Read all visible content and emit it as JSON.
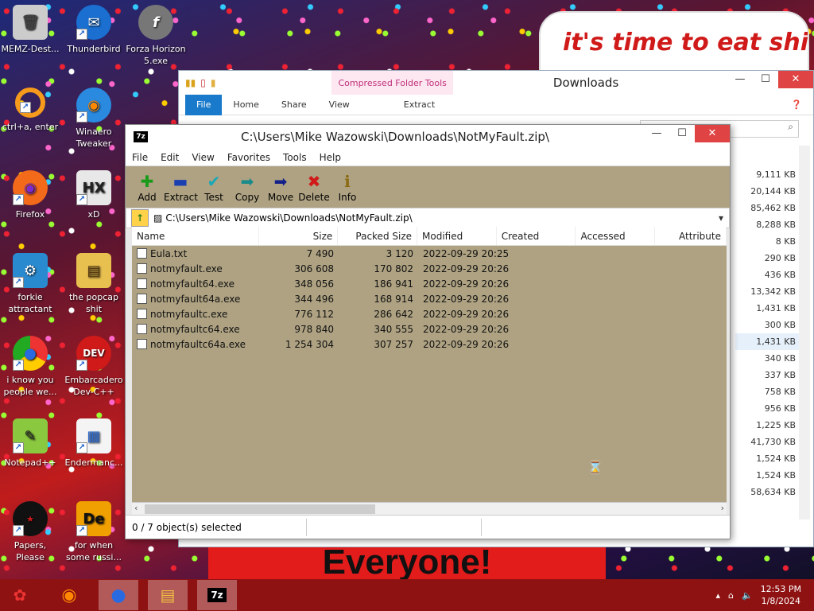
{
  "desktop": {
    "icons": [
      {
        "label": "MEMZ-Dest...",
        "icon": "recycle-bin-icon"
      },
      {
        "label": "Thunderbird",
        "icon": "thunderbird-icon"
      },
      {
        "label": "Forza Horizon 5.exe",
        "icon": "flash-icon"
      },
      {
        "label": "ctrl+a, enter",
        "icon": "ring-icon"
      },
      {
        "label": "Winaero Tweaker",
        "icon": "firefox-globe-icon"
      },
      {
        "label": "Firefox",
        "icon": "firefox-icon"
      },
      {
        "label": "xD",
        "icon": "hxd-icon"
      },
      {
        "label": "forkie attractant",
        "icon": "monitor-gear-icon"
      },
      {
        "label": "the popcap shit",
        "icon": "folder-icon"
      },
      {
        "label": "i know you people we...",
        "icon": "chrome-icon"
      },
      {
        "label": "Embarcadero Dev-C++",
        "icon": "devcpp-icon"
      },
      {
        "label": "Notepad++",
        "icon": "notepadpp-icon"
      },
      {
        "label": "Endermanc...",
        "icon": "document-icon"
      },
      {
        "label": "Papers, Please",
        "icon": "papers-please-icon"
      },
      {
        "label": "for when some russi...",
        "icon": "de-icon"
      }
    ],
    "banner_text": "it's time to eat shit",
    "wallpaper_text": "Everyone!"
  },
  "explorer": {
    "title": "Downloads",
    "context_tab": "Compressed Folder Tools",
    "tabs": [
      "File",
      "Home",
      "Share",
      "View",
      "Extract"
    ],
    "sizes": [
      "9,111 KB",
      "20,144 KB",
      "85,462 KB",
      "8,288 KB",
      "8 KB",
      "290 KB",
      "436 KB",
      "13,342 KB",
      "1,431 KB",
      "300 KB",
      "1,431 KB",
      "340 KB",
      "337 KB",
      "758 KB",
      "956 KB",
      "1,225 KB",
      "41,730 KB",
      "1,524 KB",
      "1,524 KB",
      "58,634 KB"
    ],
    "selected_index": 10
  },
  "sevenzip": {
    "title": "C:\\Users\\Mike Wazowski\\Downloads\\NotMyFault.zip\\",
    "menu": [
      "File",
      "Edit",
      "View",
      "Favorites",
      "Tools",
      "Help"
    ],
    "toolbar": [
      {
        "label": "Add",
        "glyph": "✚",
        "color": "#1a9a1a"
      },
      {
        "label": "Extract",
        "glyph": "▬",
        "color": "#1a3fb0"
      },
      {
        "label": "Test",
        "glyph": "✔",
        "color": "#18a8b8"
      },
      {
        "label": "Copy",
        "glyph": "➡",
        "color": "#1a8a8a"
      },
      {
        "label": "Move",
        "glyph": "➡",
        "color": "#14208a"
      },
      {
        "label": "Delete",
        "glyph": "✖",
        "color": "#d01a1a"
      },
      {
        "label": "Info",
        "glyph": "ℹ",
        "color": "#8a6a10"
      }
    ],
    "address": "C:\\Users\\Mike Wazowski\\Downloads\\NotMyFault.zip\\",
    "columns": [
      "Name",
      "Size",
      "Packed Size",
      "Modified",
      "Created",
      "Accessed",
      "Attribute"
    ],
    "rows": [
      {
        "name": "Eula.txt",
        "size": "7 490",
        "packed": "3 120",
        "modified": "2022-09-29 20:25"
      },
      {
        "name": "notmyfault.exe",
        "size": "306 608",
        "packed": "170 802",
        "modified": "2022-09-29 20:26"
      },
      {
        "name": "notmyfault64.exe",
        "size": "348 056",
        "packed": "186 941",
        "modified": "2022-09-29 20:26"
      },
      {
        "name": "notmyfault64a.exe",
        "size": "344 496",
        "packed": "168 914",
        "modified": "2022-09-29 20:26"
      },
      {
        "name": "notmyfaultc.exe",
        "size": "776 112",
        "packed": "286 642",
        "modified": "2022-09-29 20:26"
      },
      {
        "name": "notmyfaultc64.exe",
        "size": "978 840",
        "packed": "340 555",
        "modified": "2022-09-29 20:26"
      },
      {
        "name": "notmyfaultc64a.exe",
        "size": "1 254 304",
        "packed": "307 257",
        "modified": "2022-09-29 20:26"
      }
    ],
    "status": "0 / 7 object(s) selected"
  },
  "taskbar": {
    "apps": [
      "start-icon",
      "firefox-icon",
      "chrome-icon",
      "file-explorer-icon",
      "sevenzip-icon"
    ],
    "time": "12:53 PM",
    "date": "1/8/2024"
  }
}
